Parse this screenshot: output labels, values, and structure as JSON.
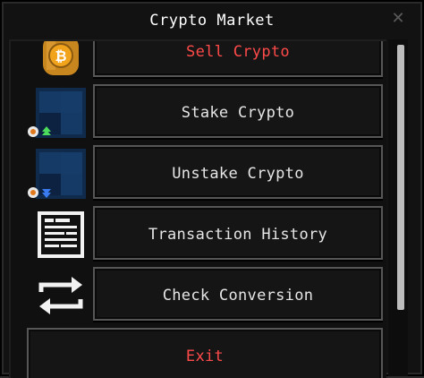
{
  "window": {
    "title": "Crypto Market"
  },
  "menu": {
    "items": [
      {
        "label": "Sell Crypto",
        "icon": "bitcoin-bag-icon",
        "color": "#ff4a4a"
      },
      {
        "label": "Stake Crypto",
        "icon": "stake-block-icon"
      },
      {
        "label": "Unstake Crypto",
        "icon": "unstake-block-icon"
      },
      {
        "label": "Transaction History",
        "icon": "document-icon"
      },
      {
        "label": "Check Conversion",
        "icon": "exchange-arrows-icon"
      }
    ],
    "exit_label": "Exit",
    "exit_color": "#ff4a4a"
  },
  "scroll": {
    "position": 0.12
  },
  "close_glyph": "✕"
}
